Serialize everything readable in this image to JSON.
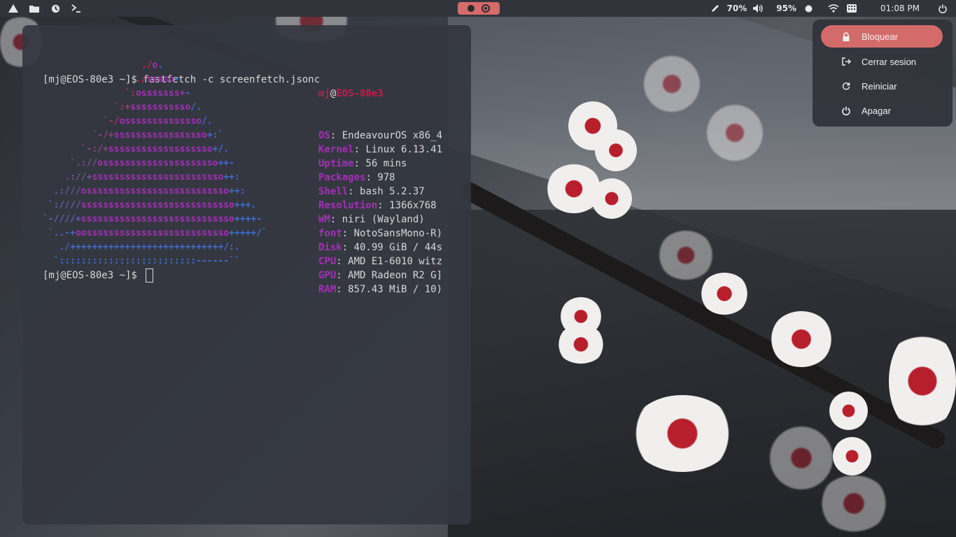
{
  "topbar": {
    "left_icons": [
      "arch-icon",
      "folder-icon",
      "update-icon",
      "terminal-icon"
    ],
    "brightness": "70%",
    "battery": "95%",
    "clock": "01:08 PM"
  },
  "terminal": {
    "command_prompt": "[mj@EOS-80e3 ~]$ ",
    "command": "fastfetch -c screenfetch.jsonc",
    "prompt2": "[mj@EOS-80e3 ~]$ ",
    "logo": [
      {
        "a": "                  ./",
        "b": "o",
        "c": "."
      },
      {
        "a": "                 ./",
        "b": "sssso",
        "c": "-"
      },
      {
        "a": "               `:",
        "b": "osssssss+",
        "c": "-"
      },
      {
        "a": "             `:+",
        "b": "sssssssssso",
        "c": "/."
      },
      {
        "a": "           `-/",
        "b": "ossssssssssssso",
        "c": "/."
      },
      {
        "a": "         `-/+",
        "b": "sssssssssssssssso",
        "c": "+:`"
      },
      {
        "a": "       `-:/+",
        "b": "sssssssssssssssssso",
        "c": "+/."
      },
      {
        "a": "     `.://",
        "b": "osssssssssssssssssssso",
        "c": "++-"
      },
      {
        "a": "    .://+",
        "b": "ssssssssssssssssssssssso",
        "c": "++:"
      },
      {
        "a": "  .:///",
        "b": "ossssssssssssssssssssssssso",
        "c": "++:"
      },
      {
        "a": " `:////",
        "b": "ssssssssssssssssssssssssssso",
        "c": "+++."
      },
      {
        "a": "`-////+",
        "b": "ssssssssssssssssssssssssssso",
        "c": "++++-"
      },
      {
        "a": " `..-+",
        "b": "oossssssssssssssssssssssssso",
        "c": "+++++/`"
      },
      {
        "a": "   ./++++++++++++++++++++++++++++/:.",
        "b": "",
        "c": ""
      },
      {
        "a": "  `:::::::::::::::::::::::::------``",
        "b": "",
        "c": ""
      }
    ],
    "info_header": {
      "user": "mj",
      "at": "@",
      "host": "EOS-80e3"
    },
    "info": [
      {
        "key": "OS",
        "value": "EndeavourOS x86_4"
      },
      {
        "key": "Kernel",
        "value": "Linux 6.13.41"
      },
      {
        "key": "Uptime",
        "value": "56 mins"
      },
      {
        "key": "Packages",
        "value": "978"
      },
      {
        "key": "Shell",
        "value": "bash 5.2.37"
      },
      {
        "key": "Resolution",
        "value": "1366x768"
      },
      {
        "key": "WM",
        "value": "niri (Wayland)"
      },
      {
        "key": "font",
        "value": "NotoSansMono-R)"
      },
      {
        "key": "Disk",
        "value": "40.99 GiB / 44s"
      },
      {
        "key": "CPU",
        "value": "AMD E1-6010 witz"
      },
      {
        "key": "GPU",
        "value": "AMD Radeon R2 G]"
      },
      {
        "key": "RAM",
        "value": "857.43 MiB / 10)"
      }
    ]
  },
  "power_menu": {
    "items": [
      {
        "label": "Bloquear",
        "icon": "lock-icon"
      },
      {
        "label": "Cerrar sesion",
        "icon": "logout-icon"
      },
      {
        "label": "Reiniciar",
        "icon": "restart-icon"
      },
      {
        "label": "Apagar",
        "icon": "power-icon"
      }
    ]
  },
  "colors": {
    "accent": "#d46b6b",
    "logo_pink": "#a52fb8",
    "logo_blue": "#3d6fd6",
    "host_red": "#c21d4a"
  }
}
